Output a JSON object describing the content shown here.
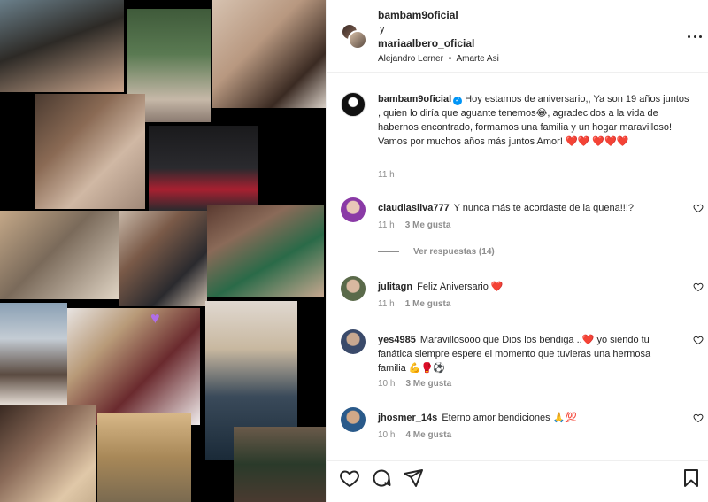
{
  "collage": {
    "sticker_icon": "purple-heart-icon",
    "colors": [
      "#2d2a26",
      "#5a6f7a",
      "#c9a58c",
      "#3b3b3b",
      "#8a7a63",
      "#6b4a3a",
      "#1c1c1c",
      "#d6d0c8",
      "#405a3c",
      "#7a5a48",
      "#4a3a30",
      "#b09078"
    ]
  },
  "header": {
    "user1": "bambam9oficial",
    "and": "y",
    "user2": "mariaalbero_oficial",
    "audio_artist": "Alejandro Lerner",
    "audio_sep": "•",
    "audio_song": "Amarte Asi",
    "more_icon": "more-horizontal-icon"
  },
  "caption": {
    "username": "bambam9oficial",
    "verified_icon": "verified-badge-icon",
    "text": "Hoy estamos de aniversario,, Ya son 19 años juntos , quien lo diría que aguante tenemos😂, agradecidos a la vida de habernos encontrado, formamos una familia y un hogar maravilloso! Vamos por muchos años más juntos Amor! ❤️❤️ ❤️❤️❤️",
    "time": "11 h"
  },
  "comments": [
    {
      "username": "claudiasilva777",
      "text": "Y nunca más te acordaste de la quena!!!?",
      "time": "11 h",
      "likes": "3 Me gusta",
      "replies": "Ver respuestas (14)",
      "avatar_color": "#8a3aa6"
    },
    {
      "username": "julitagn",
      "text": "Feliz Aniversario ❤️",
      "time": "11 h",
      "likes": "1 Me gusta",
      "avatar_color": "#5a6a4a"
    },
    {
      "username": "yes4985",
      "text": "Maravillosooo que Dios los bendiga ..❤️ yo siendo tu fanática siempre espere el momento que tuvieras una hermosa familia 💪🥊⚽",
      "time": "10 h",
      "likes": "3 Me gusta",
      "avatar_color": "#3a4a6a"
    },
    {
      "username": "jhosmer_14s",
      "text": "Eterno amor bendiciones 🙏💯",
      "time": "10 h",
      "likes": "4 Me gusta",
      "avatar_color": "#2a5a8a"
    }
  ],
  "actions": {
    "like_icon": "heart-outline-icon",
    "comment_icon": "comment-icon",
    "share_icon": "send-icon",
    "save_icon": "bookmark-icon"
  },
  "colors": {
    "text": "#262626",
    "muted": "#8e8e8e",
    "verified": "#0095f6",
    "heart": "#ed2a2a",
    "border": "#efefef"
  }
}
